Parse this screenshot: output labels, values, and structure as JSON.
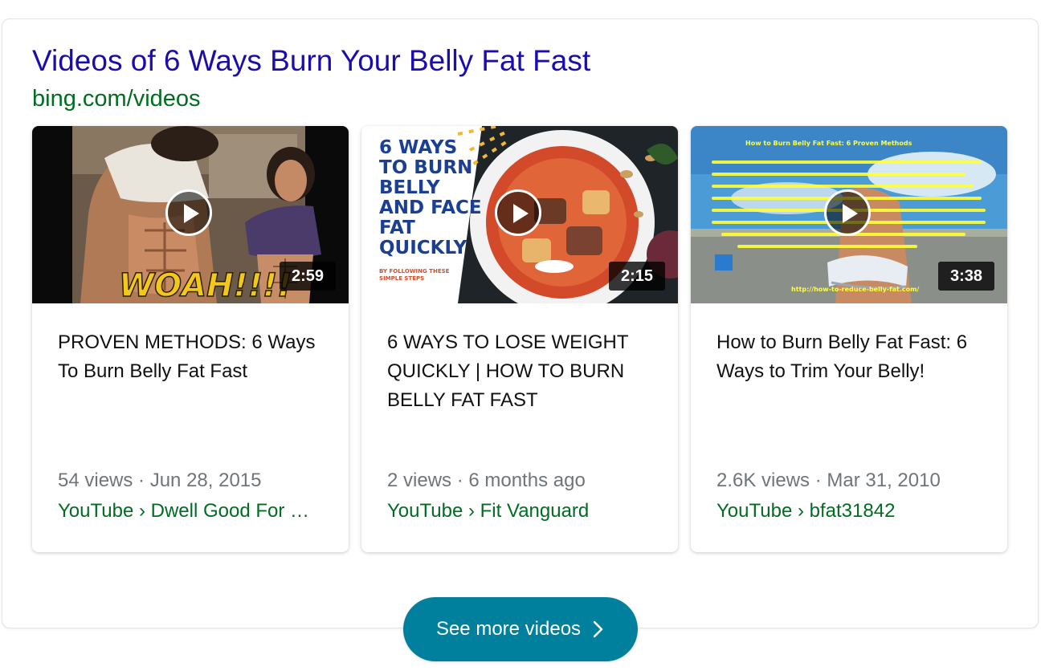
{
  "section": {
    "title": "Videos of 6 Ways Burn Your Belly Fat Fast",
    "domain": "bing.com/videos"
  },
  "videos": [
    {
      "thumbnail_text": "WOAH!!!!",
      "duration": "2:59",
      "title": "PROVEN METHODS: 6 Ways To Burn Belly Fat Fast",
      "meta": "54 views · Jun 28, 2015",
      "source": "YouTube › Dwell Good For Life"
    },
    {
      "thumbnail_text": [
        "6 WAYS",
        "TO BURN",
        "BELLY",
        "AND FACE",
        "FAT",
        "QUICKLY"
      ],
      "thumbnail_subtext": [
        "BY FOLLOWING THESE",
        "SIMPLE STEPS"
      ],
      "duration": "2:15",
      "title": "6 WAYS TO LOSE WEIGHT QUICKLY | HOW TO BURN BELLY FAT FAST",
      "meta": "2 views · 6 months ago",
      "source": "YouTube › Fit Vanguard"
    },
    {
      "thumbnail_heading": "How to Burn Belly Fat Fast: 6 Proven Methods",
      "thumbnail_url": "http://how-to-reduce-belly-fat.com/",
      "duration": "3:38",
      "title": "How to Burn Belly Fat Fast: 6 Ways to Trim Your Belly!",
      "meta": "2.6K views · Mar 31, 2010",
      "source": "YouTube › bfat31842"
    }
  ],
  "see_more": {
    "label": "See more videos",
    "icon": "chevron-right-icon"
  },
  "colors": {
    "title_link": "#1a0dab",
    "domain_green": "#006d21",
    "button_teal": "#00809d",
    "meta_gray": "#70757a"
  }
}
